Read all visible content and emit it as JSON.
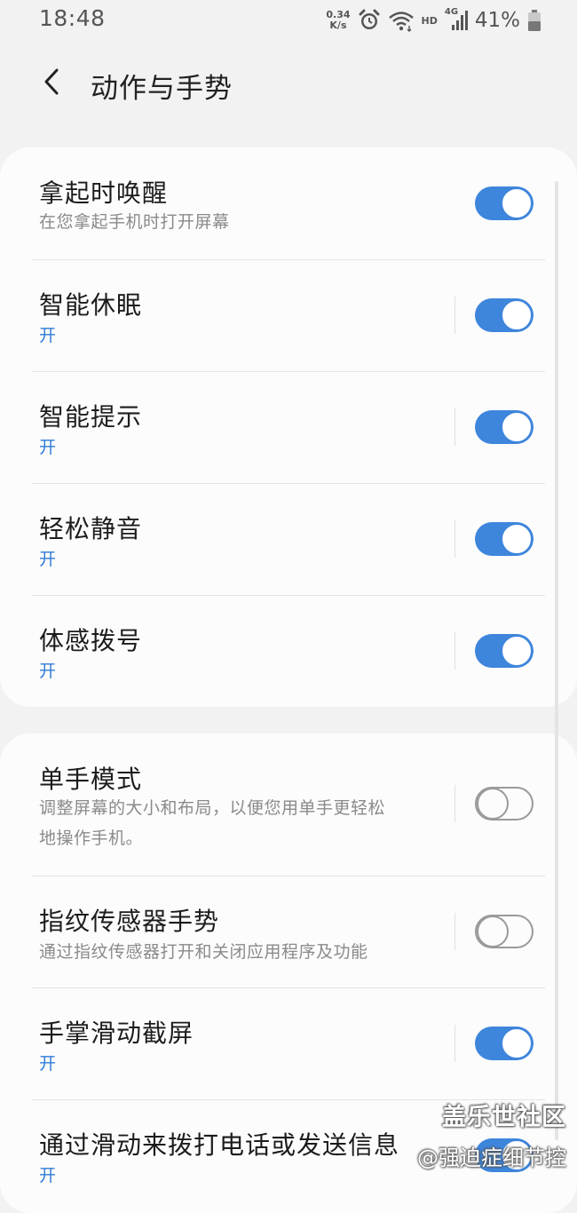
{
  "status_bar": {
    "time": "18:48",
    "net_speed_value": "0.34",
    "net_speed_unit": "K/s",
    "hd_label": "HD",
    "network_type": "4G",
    "battery_percent": "41%",
    "icons": [
      "alarm-icon",
      "wifi-icon",
      "signal-icon",
      "battery-icon"
    ]
  },
  "header": {
    "back_icon": "chevron-left-icon",
    "title": "动作与手势"
  },
  "colors": {
    "accent": "#3e85dc",
    "on_text": "#2f7bd5",
    "secondary_text": "#8a8a8a",
    "background": "#f2f2f2",
    "card": "#fcfcfc"
  },
  "group1": {
    "items": [
      {
        "title": "拿起时唤醒",
        "subtitle": "在您拿起手机时打开屏幕",
        "enabled": true
      },
      {
        "title": "智能休眠",
        "subtitle": "开",
        "enabled": true
      },
      {
        "title": "智能提示",
        "subtitle": "开",
        "enabled": true
      },
      {
        "title": "轻松静音",
        "subtitle": "开",
        "enabled": true
      },
      {
        "title": "体感拨号",
        "subtitle": "开",
        "enabled": true
      }
    ]
  },
  "group2": {
    "items": [
      {
        "title": "单手模式",
        "subtitle_line1": "调整屏幕的大小和布局，以便您用单手更轻松",
        "subtitle_line2": "地操作手机。",
        "enabled": false
      },
      {
        "title": "指纹传感器手势",
        "subtitle": "通过指纹传感器打开和关闭应用程序及功能",
        "enabled": false
      },
      {
        "title": "手掌滑动截屏",
        "subtitle": "开",
        "enabled": true
      },
      {
        "title": "通过滑动来拨打电话或发送信息",
        "subtitle": "开",
        "enabled": true
      }
    ]
  },
  "watermark": {
    "line1": "盖乐世社区",
    "line2": "@强迫症细节控"
  }
}
